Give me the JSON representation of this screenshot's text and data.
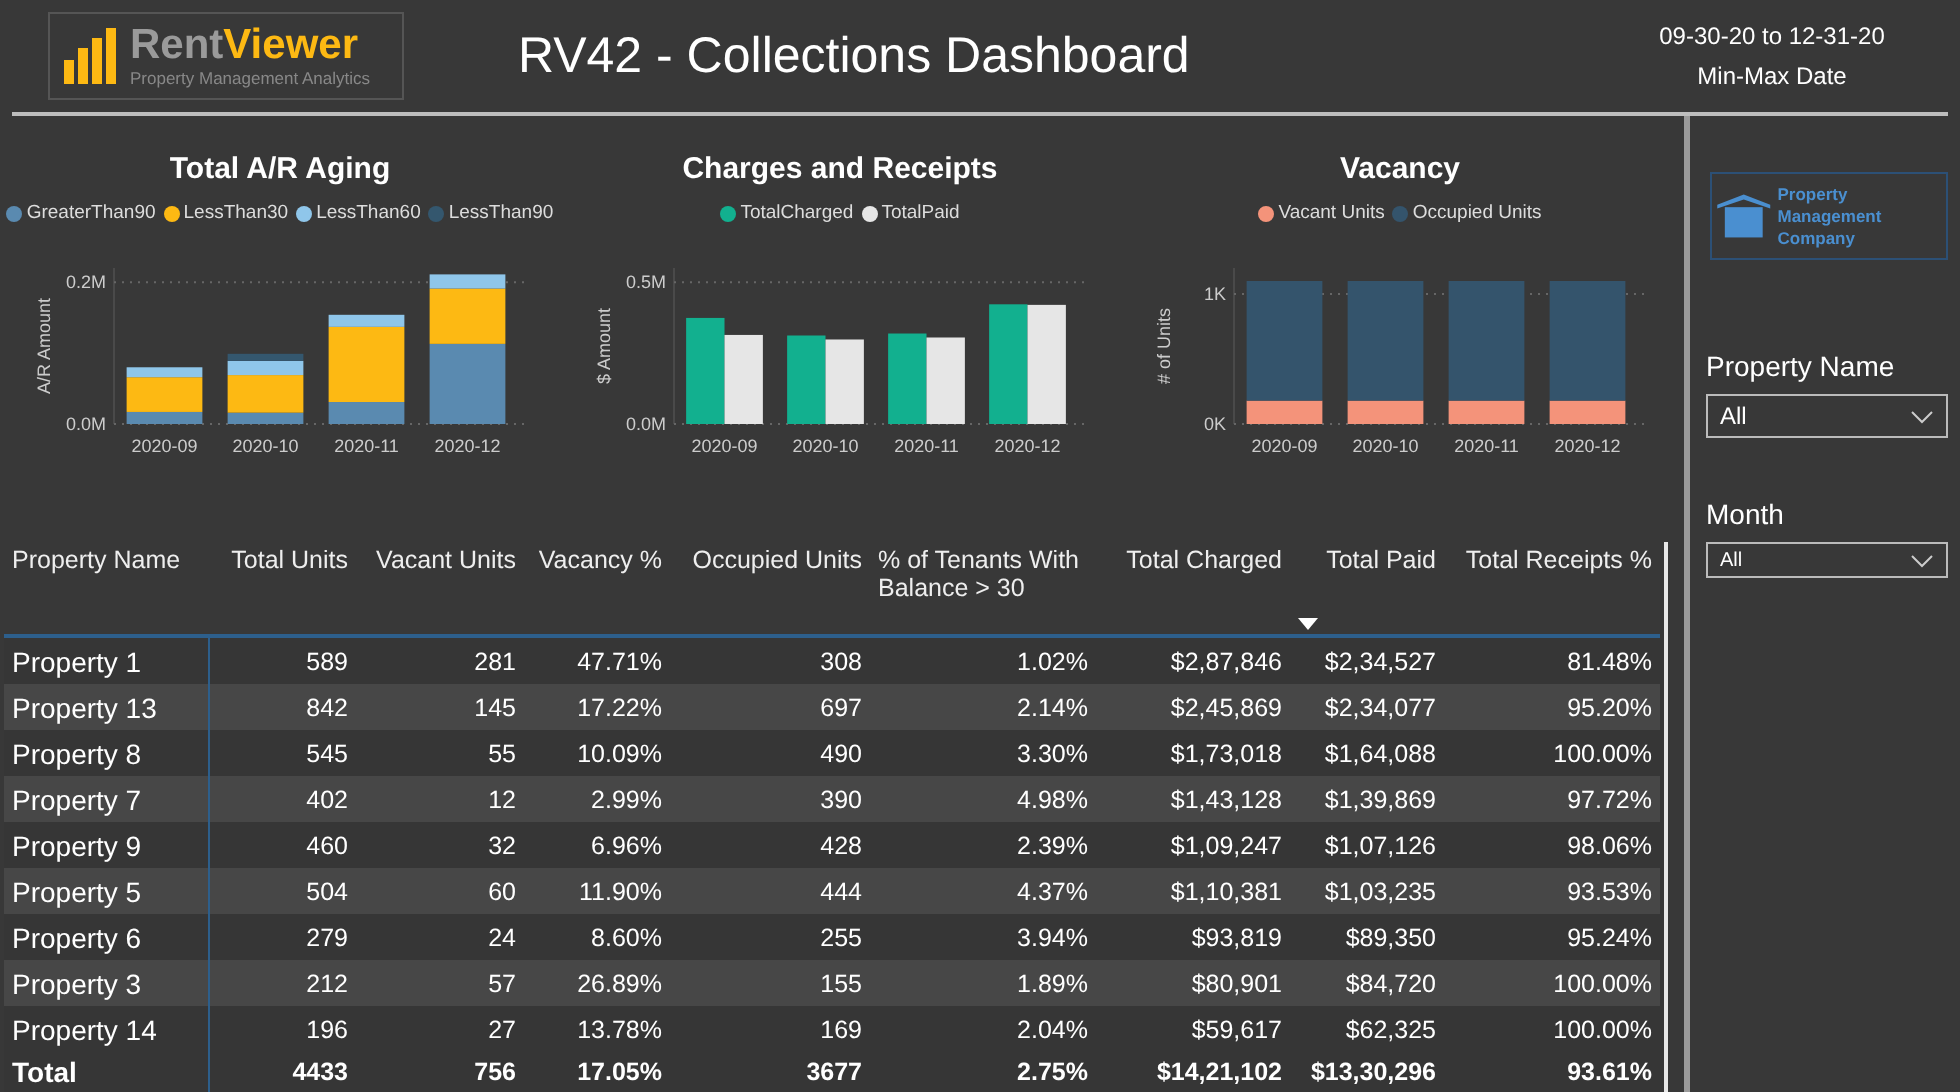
{
  "header": {
    "logo": {
      "word_1": "Rent",
      "word_2": "Viewer",
      "tagline": "Property Management Analytics"
    },
    "title": "RV42 - Collections Dashboard",
    "date_range": "09-30-20 to 12-31-20",
    "date_caption": "Min-Max Date"
  },
  "charts": [
    {
      "title": "Total A/R Aging",
      "chart_data": {
        "type": "bar",
        "stacked": true,
        "ylabel": "A/R Amount",
        "categories": [
          "2020-09",
          "2020-10",
          "2020-11",
          "2020-12"
        ],
        "yticks": [
          {
            "value": 0,
            "label": "0.0M"
          },
          {
            "value": 0.2,
            "label": "0.2M"
          }
        ],
        "ylim": [
          0,
          0.22
        ],
        "series": [
          {
            "name": "GreaterThan90",
            "color": "#5a8ab0",
            "values": [
              0.017,
              0.016,
              0.031,
              0.113
            ]
          },
          {
            "name": "LessThan30",
            "color": "#fdb913",
            "values": [
              0.049,
              0.053,
              0.106,
              0.078
            ]
          },
          {
            "name": "LessThan60",
            "color": "#8fc6ea",
            "values": [
              0.014,
              0.02,
              0.017,
              0.02
            ]
          },
          {
            "name": "LessThan90",
            "color": "#34576e",
            "values": [
              0,
              0.01,
              0,
              0
            ]
          }
        ]
      }
    },
    {
      "title": "Charges and Receipts",
      "chart_data": {
        "type": "bar",
        "stacked": false,
        "ylabel": "$ Amount",
        "categories": [
          "2020-09",
          "2020-10",
          "2020-11",
          "2020-12"
        ],
        "yticks": [
          {
            "value": 0,
            "label": "0.0M"
          },
          {
            "value": 0.5,
            "label": "0.5M"
          }
        ],
        "ylim": [
          0,
          0.55
        ],
        "series": [
          {
            "name": "TotalCharged",
            "color": "#12b08f",
            "values": [
              0.374,
              0.312,
              0.319,
              0.422
            ]
          },
          {
            "name": "TotalPaid",
            "color": "#e6e6e6",
            "values": [
              0.314,
              0.298,
              0.305,
              0.42
            ]
          }
        ]
      }
    },
    {
      "title": "Vacancy",
      "chart_data": {
        "type": "bar",
        "stacked": true,
        "ylabel": "# of Units",
        "categories": [
          "2020-09",
          "2020-10",
          "2020-11",
          "2020-12"
        ],
        "yticks": [
          {
            "value": 0,
            "label": "0K"
          },
          {
            "value": 1000,
            "label": "1K"
          }
        ],
        "ylim": [
          0,
          1200
        ],
        "series": [
          {
            "name": "Vacant Units",
            "color": "#f4937a",
            "values": [
              180,
              180,
              180,
              180
            ]
          },
          {
            "name": "Occupied Units",
            "color": "#34546c",
            "values": [
              920,
              920,
              920,
              920
            ]
          }
        ]
      }
    }
  ],
  "table": {
    "columns": [
      {
        "label": "Property Name",
        "sorted": false
      },
      {
        "label": "Total Units",
        "sorted": false
      },
      {
        "label": "Vacant Units",
        "sorted": false
      },
      {
        "label": "Vacancy %",
        "sorted": false
      },
      {
        "label": "Occupied Units",
        "sorted": false
      },
      {
        "label": "% of Tenants With Balance > 30",
        "sorted": false
      },
      {
        "label": "Total Charged",
        "sorted": false
      },
      {
        "label": "Total Paid",
        "sorted": true
      },
      {
        "label": "Total Receipts %",
        "sorted": false
      }
    ],
    "rows": [
      [
        "Property 1",
        "589",
        "281",
        "47.71%",
        "308",
        "1.02%",
        "$2,87,846",
        "$2,34,527",
        "81.48%"
      ],
      [
        "Property 13",
        "842",
        "145",
        "17.22%",
        "697",
        "2.14%",
        "$2,45,869",
        "$2,34,077",
        "95.20%"
      ],
      [
        "Property 8",
        "545",
        "55",
        "10.09%",
        "490",
        "3.30%",
        "$1,73,018",
        "$1,64,088",
        "100.00%"
      ],
      [
        "Property 7",
        "402",
        "12",
        "2.99%",
        "390",
        "4.98%",
        "$1,43,128",
        "$1,39,869",
        "97.72%"
      ],
      [
        "Property 9",
        "460",
        "32",
        "6.96%",
        "428",
        "2.39%",
        "$1,09,247",
        "$1,07,126",
        "98.06%"
      ],
      [
        "Property 5",
        "504",
        "60",
        "11.90%",
        "444",
        "4.37%",
        "$1,10,381",
        "$1,03,235",
        "93.53%"
      ],
      [
        "Property 6",
        "279",
        "24",
        "8.60%",
        "255",
        "3.94%",
        "$93,819",
        "$89,350",
        "95.24%"
      ],
      [
        "Property 3",
        "212",
        "57",
        "26.89%",
        "155",
        "1.89%",
        "$80,901",
        "$84,720",
        "100.00%"
      ],
      [
        "Property 14",
        "196",
        "27",
        "13.78%",
        "169",
        "2.04%",
        "$59,617",
        "$62,325",
        "100.00%"
      ]
    ],
    "total": [
      "Total",
      "4433",
      "756",
      "17.05%",
      "3677",
      "2.75%",
      "$14,21,102",
      "$13,30,296",
      "93.61%"
    ]
  },
  "sidebar": {
    "company_logo": "Property Management Company",
    "filters": [
      {
        "label": "Property Name",
        "value": "All"
      },
      {
        "label": "Month",
        "value": "All"
      }
    ]
  }
}
